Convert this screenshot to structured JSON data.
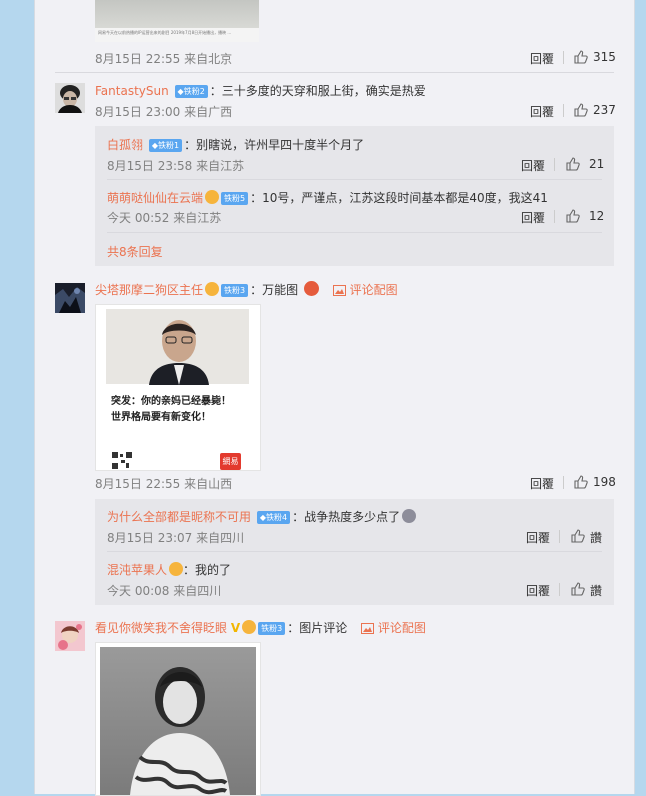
{
  "top": {
    "image_caption": "网易今天在以前热播的IP运营出来的剧目 2019年7月8日开始播出，播映 ...",
    "time": "8月15日 22:55 来自北京",
    "reply": "回覆",
    "likes": "315"
  },
  "c1": {
    "name": "FantastySun",
    "badge": "铁粉2",
    "text": "：三十多度的天穿和服上街，确实是热爱",
    "time": "8月15日 23:00 来自广西",
    "reply": "回覆",
    "likes": "237",
    "subs": [
      {
        "name": "白孤翎",
        "badge": "铁粉1",
        "text": "：别瞎说，许州早四十度半个月了",
        "time": "8月15日 23:58 来自江苏",
        "reply": "回覆",
        "likes": "21"
      },
      {
        "name": "萌萌哒仙仙在云端",
        "badge": "铁粉5",
        "text": "：10号，严谨点，江苏这段时间基本都是40度，我这41",
        "time": "今天 00:52 来自江苏",
        "reply": "回覆",
        "likes": "12"
      }
    ],
    "more": "共8条回复"
  },
  "c2": {
    "name": "尖塔那摩二狗区主任",
    "badge": "铁粉3",
    "text": "：万能图",
    "image_comment": "评论配图",
    "image_title": "突发：你的亲妈已经暴毙！",
    "image_title2": "世界格局要有新变化！",
    "image_brand": "網易",
    "time": "8月15日 22:55 来自山西",
    "reply": "回覆",
    "likes": "198",
    "subs": [
      {
        "name": "为什么全部都是昵称不可用",
        "badge": "铁粉4",
        "text": "：战争热度多少点了",
        "time": "8月15日 23:07 来自四川",
        "reply": "回覆",
        "likes": "讚"
      },
      {
        "name": "混沌苹果人",
        "text": "：我的了",
        "time": "今天 00:08 来自四川",
        "reply": "回覆",
        "likes": "讚"
      }
    ]
  },
  "c3": {
    "name": "看见你微笑我不舍得眨眼",
    "badge": "铁粉3",
    "text": "：图片评论",
    "image_comment": "评论配图"
  },
  "colors": {
    "name": "#eb7350",
    "badge": "#5aa6f0",
    "bg": "#f1f1f5",
    "sub": "#e6e6ea",
    "side": "#b5d7ee"
  }
}
